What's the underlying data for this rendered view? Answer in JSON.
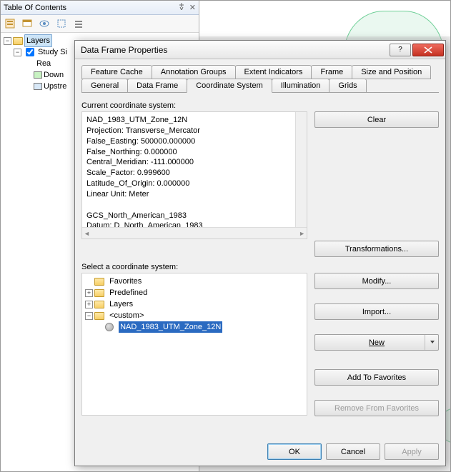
{
  "toc": {
    "title": "Table Of Contents",
    "pin_icon": "pin-icon",
    "close_icon": "close-icon",
    "toolbar_icons": [
      "list-by-draw-icon",
      "list-by-source-icon",
      "list-by-visibility-icon",
      "list-by-selection-icon",
      "options-icon"
    ],
    "root_label": "Layers",
    "items": [
      {
        "label": "Study Si",
        "checked": true,
        "color": null
      },
      {
        "label": "Rea",
        "checked": null,
        "color": null
      },
      {
        "label": "Down",
        "checked": null,
        "color": "#c8f2c2"
      },
      {
        "label": "Upstre",
        "checked": null,
        "color": "#d8e8f7"
      }
    ]
  },
  "dialog": {
    "title": "Data Frame Properties",
    "tabs_top": [
      "Feature Cache",
      "Annotation Groups",
      "Extent Indicators",
      "Frame",
      "Size and Position"
    ],
    "tabs_bottom": [
      "General",
      "Data Frame",
      "Coordinate System",
      "Illumination",
      "Grids"
    ],
    "active_tab": "Coordinate System",
    "current_label": "Current coordinate system:",
    "current_text": "NAD_1983_UTM_Zone_12N\nProjection: Transverse_Mercator\nFalse_Easting: 500000.000000\nFalse_Northing: 0.000000\nCentral_Meridian: -111.000000\nScale_Factor: 0.999600\nLatitude_Of_Origin: 0.000000\nLinear Unit: Meter\n\nGCS_North_American_1983\nDatum: D_North_American_1983",
    "select_label": "Select a coordinate system:",
    "cs_tree": {
      "folders": [
        "Favorites",
        "Predefined",
        "Layers",
        "<custom>"
      ],
      "selected": "NAD_1983_UTM_Zone_12N"
    },
    "btn_clear": "Clear",
    "btn_transformations": "Transformations...",
    "btn_modify": "Modify...",
    "btn_import": "Import...",
    "btn_new": "New",
    "btn_add_fav": "Add To Favorites",
    "btn_rem_fav": "Remove From Favorites",
    "btn_ok": "OK",
    "btn_cancel": "Cancel",
    "btn_apply": "Apply"
  }
}
